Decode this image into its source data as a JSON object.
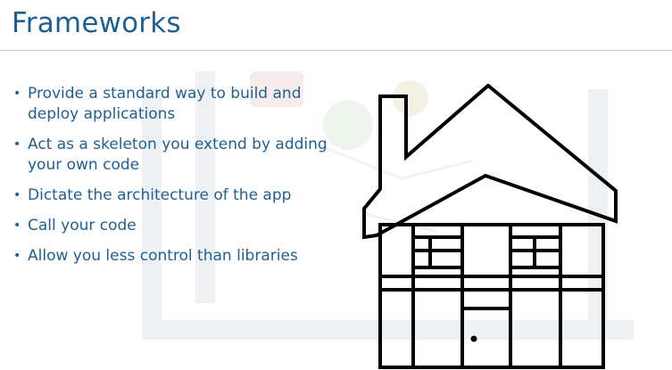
{
  "slide": {
    "title": "Frameworks",
    "bullets": [
      "Provide a standard way to build and deploy applications",
      "Act as a skeleton you extend by adding your own code",
      "Dictate the architecture of the app",
      "Call your code",
      "Allow you less control than libraries"
    ],
    "bullet_marker": "•"
  },
  "colors": {
    "title": "#1f5f94",
    "text": "#1f5f94",
    "rule": "#c8cdd3",
    "drawing": "#000000"
  },
  "illustration": {
    "icon": "house-icon"
  }
}
